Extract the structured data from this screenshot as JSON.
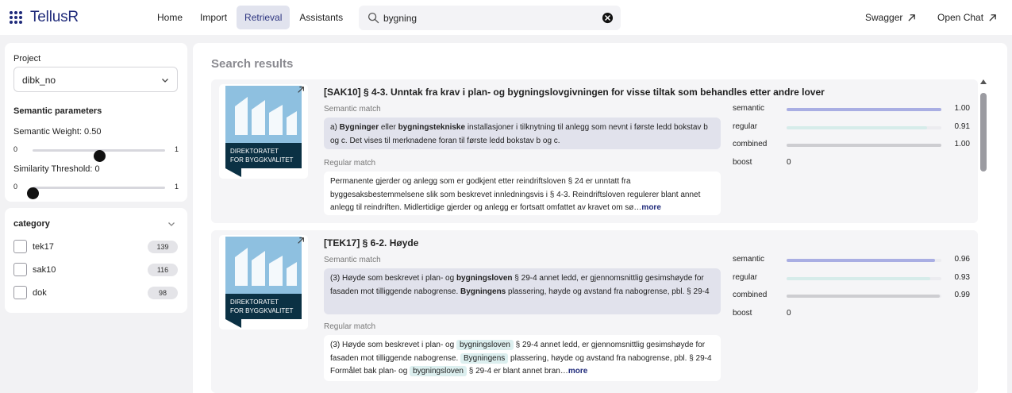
{
  "app": {
    "name": "TellusR"
  },
  "nav": {
    "items": [
      "Home",
      "Import",
      "Retrieval",
      "Assistants"
    ],
    "active": "Retrieval"
  },
  "search": {
    "value": "bygning",
    "placeholder": ""
  },
  "top_links": {
    "swagger": "Swagger",
    "open_chat": "Open Chat"
  },
  "sidebar": {
    "project_label": "Project",
    "project_value": "dibk_no",
    "semantic_params_title": "Semantic parameters",
    "semantic_weight": {
      "label": "Semantic Weight: 0.50",
      "min": "0",
      "max": "1",
      "value": 0.5
    },
    "similarity_threshold": {
      "label": "Similarity Threshold: 0",
      "min": "0",
      "max": "1",
      "value": 0
    },
    "category": {
      "title": "category",
      "items": [
        {
          "label": "tek17",
          "count": "139",
          "checked": false
        },
        {
          "label": "sak10",
          "count": "116",
          "checked": false
        },
        {
          "label": "dok",
          "count": "98",
          "checked": false
        }
      ]
    }
  },
  "results": {
    "title": "Search results",
    "semantic_match_label": "Semantic match",
    "regular_match_label": "Regular match",
    "more_label": "more",
    "logo_text": [
      "DIREKTORATET",
      "FOR BYGGKVALITET"
    ],
    "score_labels": {
      "semantic": "semantic",
      "regular": "regular",
      "combined": "combined",
      "boost": "boost"
    },
    "colors": {
      "semantic": "#a9aee3",
      "regular": "#d6ecea",
      "combined": "#cdcdd1",
      "logo_blue": "#8ec0e0",
      "logo_dark": "#0b3144"
    },
    "cards": [
      {
        "title": "[SAK10] § 4-3. Unntak fra krav i plan- og bygningslovgivningen for visse tiltak som behandles etter andre lover",
        "semantic_parts": [
          {
            "t": "a) ",
            "b": false
          },
          {
            "t": "Bygninger",
            "b": true
          },
          {
            "t": " eller ",
            "b": false
          },
          {
            "t": "bygningstekniske",
            "b": true
          },
          {
            "t": " installasjoner i tilknytning til anlegg som nevnt i første ledd bokstav b og c. Det vises til merknadene foran til første ledd bokstav b og c.",
            "b": false
          }
        ],
        "regular_parts": [
          {
            "t": "Permanente gjerder og anlegg som er godkjent etter reindriftsloven § 24 er unntatt fra byggesaksbestemmelsene slik som beskrevet innledningsvis i § 4-3. Reindriftsloven regulerer blant annet anlegg til reindriften. Midlertidige gjerder og anlegg er fortsatt omfattet av kravet om sø…",
            "h": false
          }
        ],
        "scores": {
          "semantic": 1.0,
          "regular": 0.91,
          "combined": 1.0
        },
        "score_text": {
          "semantic": "1.00",
          "regular": "0.91",
          "combined": "1.00",
          "boost": "0"
        }
      },
      {
        "title": "[TEK17] § 6-2. Høyde",
        "semantic_parts": [
          {
            "t": "(3) Høyde som beskrevet i plan- og ",
            "b": false
          },
          {
            "t": "bygningsloven",
            "b": true
          },
          {
            "t": " § 29-4 annet ledd, er gjennomsnittlig gesimshøyde for fasaden mot tilliggende nabogrense. ",
            "b": false
          },
          {
            "t": "Bygningens",
            "b": true
          },
          {
            "t": " plassering, høyde og avstand fra nabogrense, pbl. § 29-4",
            "b": false
          }
        ],
        "regular_parts": [
          {
            "t": "(3) Høyde som beskrevet i plan- og ",
            "h": false
          },
          {
            "t": "bygningsloven",
            "h": true
          },
          {
            "t": " § 29-4 annet ledd, er gjennomsnittlig gesimshøyde for fasaden mot tilliggende nabogrense. ",
            "h": false
          },
          {
            "t": "Bygningens",
            "h": true
          },
          {
            "t": " plassering, høyde og avstand fra nabogrense, pbl. § 29-4 Formålet bak plan- og ",
            "h": false
          },
          {
            "t": "bygningsloven",
            "h": true
          },
          {
            "t": " § 29-4 er blant annet bran…",
            "h": false
          }
        ],
        "scores": {
          "semantic": 0.96,
          "regular": 0.93,
          "combined": 0.99
        },
        "score_text": {
          "semantic": "0.96",
          "regular": "0.93",
          "combined": "0.99",
          "boost": "0"
        }
      }
    ]
  }
}
